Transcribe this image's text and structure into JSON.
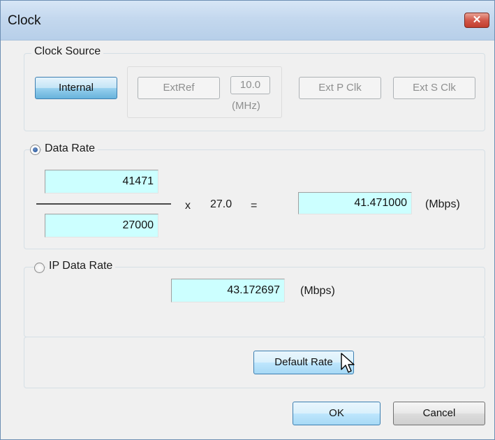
{
  "window": {
    "title": "Clock",
    "close_icon": "close-icon"
  },
  "clock_source": {
    "label": "Clock Source",
    "internal_label": "Internal",
    "extref_label": "ExtRef",
    "freq_value": "10.0",
    "freq_unit": "(MHz)",
    "ext_p_label": "Ext P Clk",
    "ext_s_label": "Ext S Clk"
  },
  "data_rate": {
    "label": "Data Rate",
    "selected": true,
    "numerator": "41471",
    "denominator": "27000",
    "times_sign": "x",
    "multiplier": "27.0",
    "equals_sign": "=",
    "result": "41.471000",
    "unit": "(Mbps)"
  },
  "ip_data_rate": {
    "label": "IP Data Rate",
    "selected": false,
    "value": "43.172697",
    "unit": "(Mbps)"
  },
  "default_rate_label": "Default Rate",
  "ok_label": "OK",
  "cancel_label": "Cancel",
  "colors": {
    "field_bg": "#ccffff",
    "accent": "#3c7fb1",
    "close": "#c23e2e"
  }
}
